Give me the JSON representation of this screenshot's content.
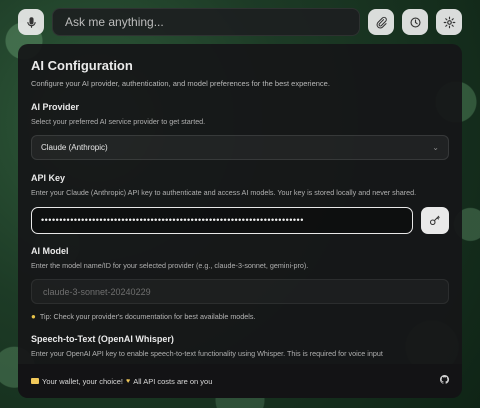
{
  "topbar": {
    "search_placeholder": "Ask me anything...",
    "icons": [
      "mic-icon",
      "paperclip-icon",
      "history-icon",
      "settings-icon"
    ]
  },
  "config": {
    "title": "AI Configuration",
    "subtitle": "Configure your AI provider, authentication, and model preferences for the best experience."
  },
  "provider": {
    "label": "AI Provider",
    "description": "Select your preferred AI service provider to get started.",
    "selected": "Claude (Anthropic)"
  },
  "api_key": {
    "label": "API Key",
    "description": "Enter your Claude (Anthropic) API key to authenticate and access AI models. Your key is stored locally and never shared.",
    "masked_value": "••••••••••••••••••••••••••••••••••••••••••••••••••••••••••••••••••••••••"
  },
  "model": {
    "label": "AI Model",
    "description": "Enter the model name/ID for your selected provider (e.g., claude-3-sonnet, gemini-pro).",
    "placeholder": "claude-3-sonnet-20240229",
    "tip": "Tip: Check your provider's documentation for best available models."
  },
  "speech": {
    "label": "Speech-to-Text (OpenAI Whisper)",
    "description": "Enter your OpenAI API key to enable speech-to-text functionality using Whisper. This is required for voice input"
  },
  "footer": {
    "text_a": "Your wallet, your choice!",
    "text_b": "All API costs are on you"
  },
  "colors": {
    "panel": "#161618",
    "accent_light": "#e9e9e9",
    "tip_bulb": "#e8c44a"
  }
}
